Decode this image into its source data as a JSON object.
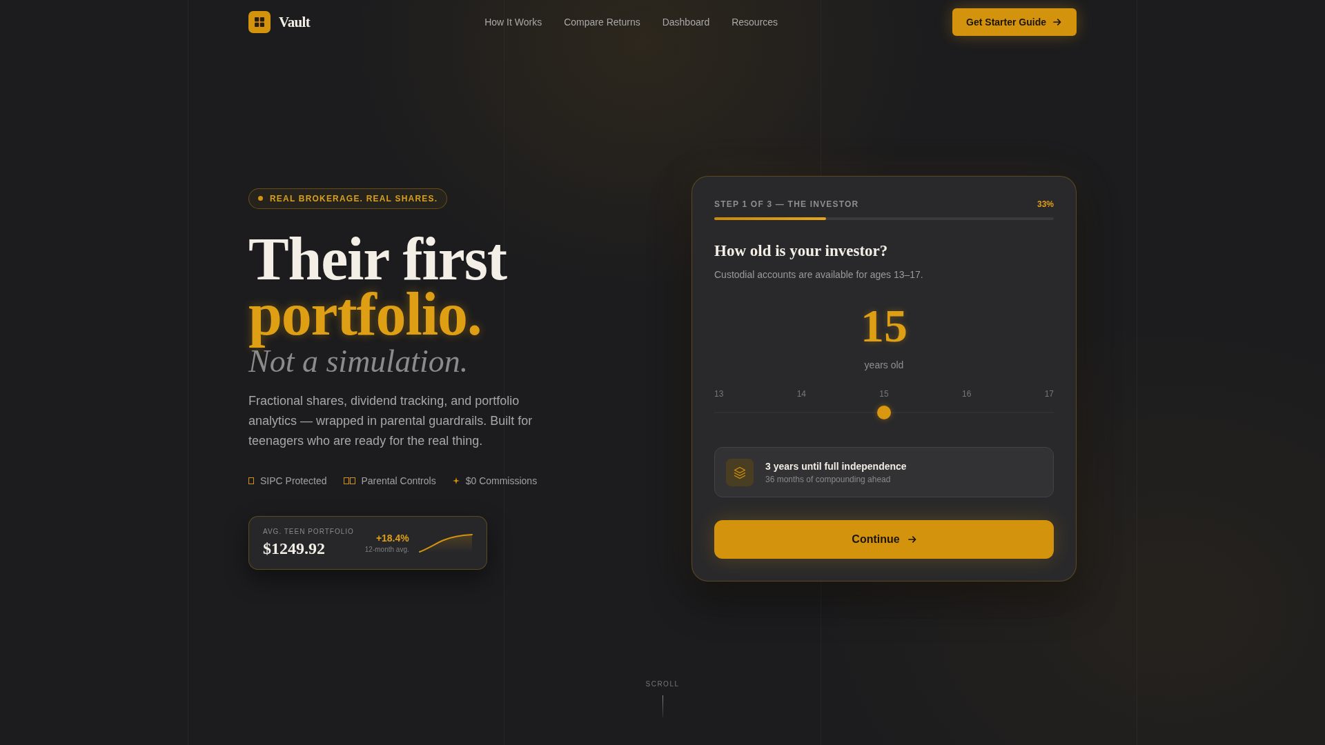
{
  "nav": {
    "brand": "Vault",
    "links": [
      {
        "label": "How It Works"
      },
      {
        "label": "Compare Returns"
      },
      {
        "label": "Dashboard"
      },
      {
        "label": "Resources"
      }
    ],
    "cta": {
      "label": "Get Starter Guide"
    }
  },
  "hero": {
    "badge": "REAL BROKERAGE. REAL SHARES.",
    "headline": "Their first",
    "headline_accent": "portfolio.",
    "tagline": "Not a simulation.",
    "description": "Fractional shares, dividend tracking, and portfolio analytics — wrapped in parental guardrails. Built for teenagers who are ready for the real thing.",
    "features": [
      {
        "kind": "box",
        "label": "SIPC Protected"
      },
      {
        "kind": "box-pair",
        "label": "Parental Controls"
      },
      {
        "kind": "sparkle",
        "label": "$0 Commissions"
      }
    ],
    "stat_card": {
      "label": "AVG. TEEN PORTFOLIO",
      "value": "$1249.92",
      "change": "+18.4%",
      "change_note": "12-month avg."
    }
  },
  "wizard": {
    "step": "STEP 1 OF 3 — THE INVESTOR",
    "percent": "33%",
    "progress": {
      "level": 0.33
    },
    "question": "How old is your investor?",
    "hint": "Custodial accounts are available for ages 13–17.",
    "value": "15",
    "unit": "years old",
    "slider": {
      "ticks": [
        "13",
        "14",
        "15",
        "16",
        "17"
      ],
      "level": 0.5
    },
    "info": {
      "title": "3 years until full independence",
      "subtitle": "36 months of compounding ahead"
    },
    "button": {
      "label": "Continue"
    }
  },
  "scroll_hint": "SCROLL"
}
